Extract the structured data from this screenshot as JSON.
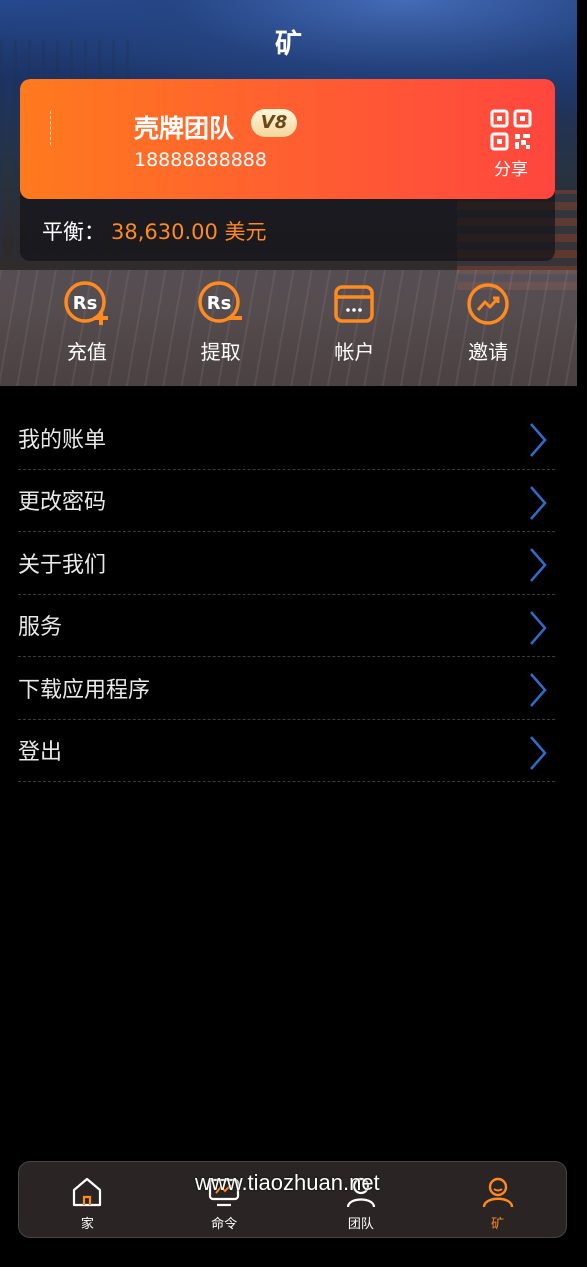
{
  "header": {
    "title": "矿"
  },
  "profile": {
    "team_name": "壳牌团队",
    "level": "V8",
    "phone": "18888888888",
    "share_label": "分享",
    "share_icon": "qr-code-icon"
  },
  "balance": {
    "label": "平衡：",
    "amount": "38,630.00 美元"
  },
  "actions": [
    {
      "label": "充值",
      "icon": "rupee-add-icon"
    },
    {
      "label": "提取",
      "icon": "rupee-withdraw-icon"
    },
    {
      "label": "帐户",
      "icon": "card-icon"
    },
    {
      "label": "邀请",
      "icon": "trend-icon"
    }
  ],
  "menu": [
    {
      "label": "我的账单"
    },
    {
      "label": "更改密码"
    },
    {
      "label": "关于我们"
    },
    {
      "label": "服务"
    },
    {
      "label": "下载应用程序"
    },
    {
      "label": "登出"
    }
  ],
  "tabbar": [
    {
      "label": "家",
      "icon": "home-icon"
    },
    {
      "label": "命令",
      "icon": "monitor-icon"
    },
    {
      "label": "团队",
      "icon": "user-icon"
    },
    {
      "label": "矿",
      "icon": "user-circle-icon",
      "active": true
    }
  ],
  "watermark": "www.tiaozhuan.net",
  "colors": {
    "accent": "#ff8a1e",
    "card_start": "#ff7a1e",
    "card_end": "#ff463e",
    "chevron": "#2f6cc9"
  }
}
